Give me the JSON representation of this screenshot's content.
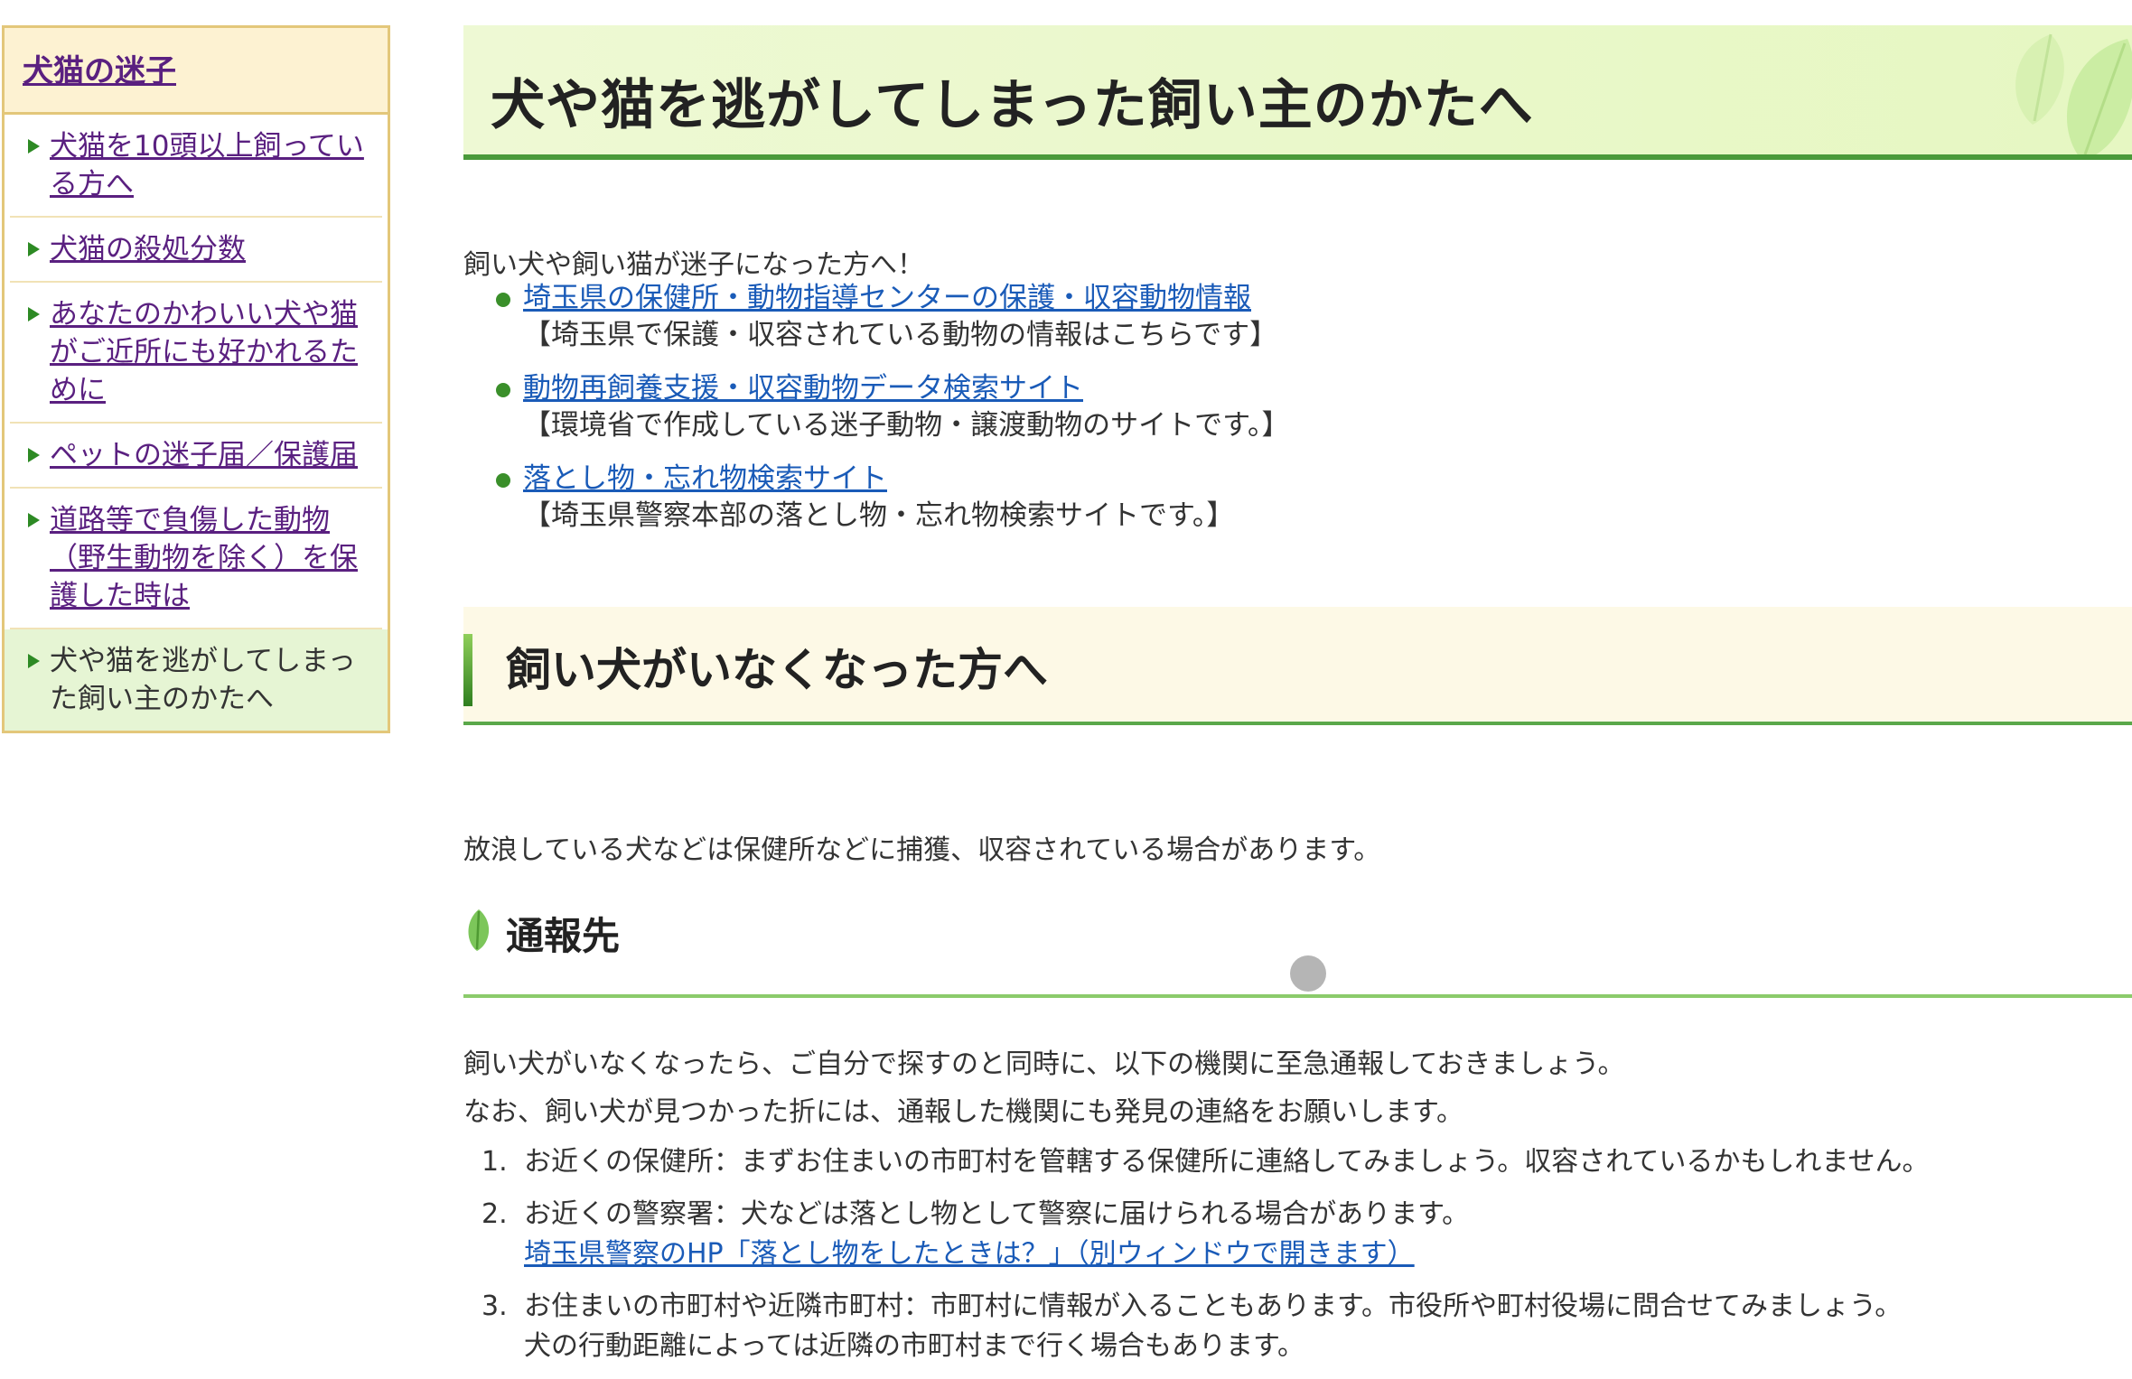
{
  "sidebar": {
    "heading": "犬猫の迷子",
    "items": [
      {
        "label": "犬猫を10頭以上飼っている方へ"
      },
      {
        "label": "犬猫の殺処分数"
      },
      {
        "label": "あなたのかわいい犬や猫がご近所にも好かれるために"
      },
      {
        "label": "ペットの迷子届／保護届"
      },
      {
        "label": "道路等で負傷した動物（野生動物を除く）を保護した時は"
      },
      {
        "label": "犬や猫を逃がしてしまった飼い主のかたへ"
      }
    ]
  },
  "page": {
    "title": "犬や猫を逃がしてしまった飼い主のかたへ",
    "intro": "飼い犬や飼い猫が迷子になった方へ！",
    "links": [
      {
        "label": "埼玉県の保健所・動物指導センターの保護・収容動物情報",
        "desc": "【埼玉県で保護・収容されている動物の情報はこちらです】"
      },
      {
        "label": "動物再飼養支援・収容動物データ検索サイト",
        "desc": "【環境省で作成している迷子動物・譲渡動物のサイトです。】"
      },
      {
        "label": "落とし物・忘れ物検索サイト",
        "desc": "【埼玉県警察本部の落とし物・忘れ物検索サイトです。】"
      }
    ],
    "section_heading": "飼い犬がいなくなった方へ",
    "section_text": "放浪している犬などは保健所などに捕獲、収容されている場合があります。",
    "sub_heading": "通報先",
    "para1": "飼い犬がいなくなったら、ご自分で探すのと同時に、以下の機関に至急通報しておきましょう。",
    "para2": "なお、飼い犬が見つかった折には、通報した機関にも発見の連絡をお願いします。",
    "steps": [
      {
        "num": "1.",
        "text": "お近くの保健所：まずお住まいの市町村を管轄する保健所に連絡してみましょう。収容されているかもしれません。"
      },
      {
        "num": "2.",
        "text": "お近くの警察署：犬などは落とし物として警察に届けられる場合があります。",
        "link": "埼玉県警察のHP「落とし物をしたときは？」（別ウィンドウで開きます）"
      },
      {
        "num": "3.",
        "text": "お住まいの市町村や近隣市町村：市町村に情報が入ることもあります。市役所や町村役場に問合せてみましょう。",
        "sub": "犬の行動距離によっては近隣の市町村まで行く場合もあります。"
      }
    ]
  },
  "colors": {
    "link": "#1a5bb8",
    "visited": "#5a2080",
    "green_accent": "#4a9a3a",
    "sidebar_border": "#e3c77a"
  }
}
